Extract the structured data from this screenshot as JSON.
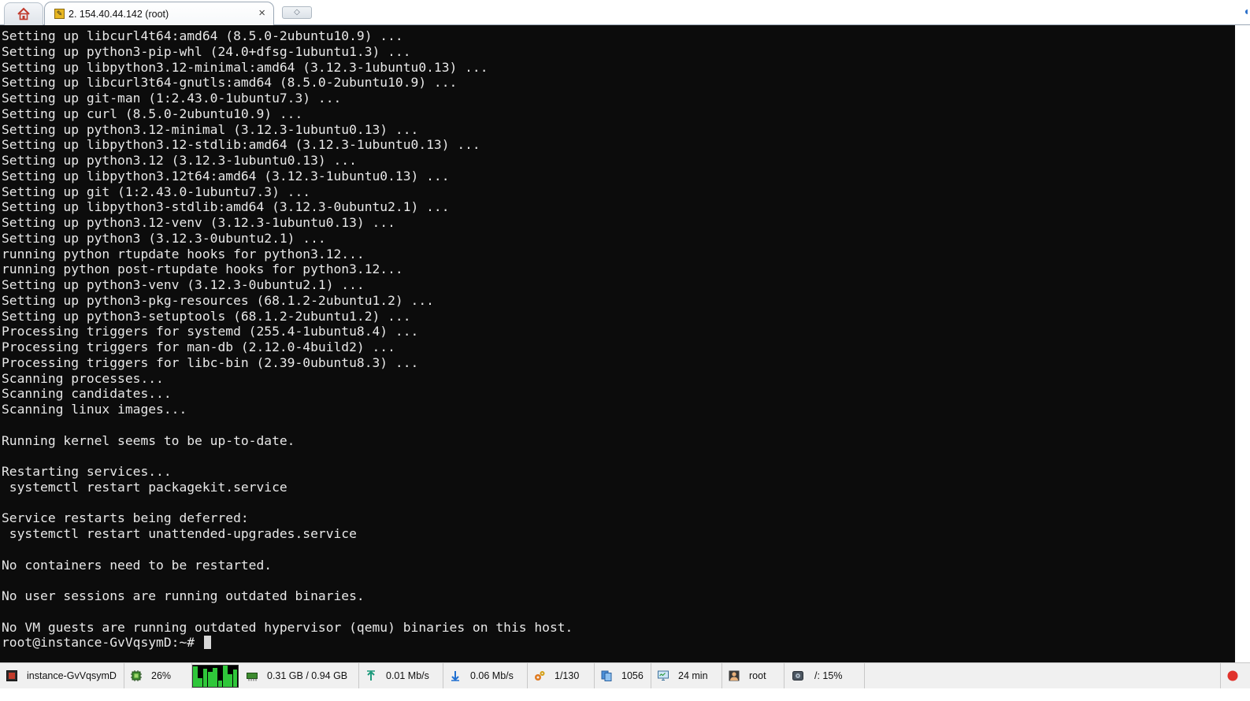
{
  "tabs": {
    "home_icon": "home-icon",
    "session_title": "2. 154.40.44.142 (root)",
    "session_icon": "terminal-icon",
    "close_glyph": "×",
    "new_tab_glyph": "◇"
  },
  "terminal": {
    "lines": [
      "Setting up libcurl4t64:amd64 (8.5.0-2ubuntu10.9) ...",
      "Setting up python3-pip-whl (24.0+dfsg-1ubuntu1.3) ...",
      "Setting up libpython3.12-minimal:amd64 (3.12.3-1ubuntu0.13) ...",
      "Setting up libcurl3t64-gnutls:amd64 (8.5.0-2ubuntu10.9) ...",
      "Setting up git-man (1:2.43.0-1ubuntu7.3) ...",
      "Setting up curl (8.5.0-2ubuntu10.9) ...",
      "Setting up python3.12-minimal (3.12.3-1ubuntu0.13) ...",
      "Setting up libpython3.12-stdlib:amd64 (3.12.3-1ubuntu0.13) ...",
      "Setting up python3.12 (3.12.3-1ubuntu0.13) ...",
      "Setting up libpython3.12t64:amd64 (3.12.3-1ubuntu0.13) ...",
      "Setting up git (1:2.43.0-1ubuntu7.3) ...",
      "Setting up libpython3-stdlib:amd64 (3.12.3-0ubuntu2.1) ...",
      "Setting up python3.12-venv (3.12.3-1ubuntu0.13) ...",
      "Setting up python3 (3.12.3-0ubuntu2.1) ...",
      "running python rtupdate hooks for python3.12...",
      "running python post-rtupdate hooks for python3.12...",
      "Setting up python3-venv (3.12.3-0ubuntu2.1) ...",
      "Setting up python3-pkg-resources (68.1.2-2ubuntu1.2) ...",
      "Setting up python3-setuptools (68.1.2-2ubuntu1.2) ...",
      "Processing triggers for systemd (255.4-1ubuntu8.4) ...",
      "Processing triggers for man-db (2.12.0-4build2) ...",
      "Processing triggers for libc-bin (2.39-0ubuntu8.3) ...",
      "Scanning processes...",
      "Scanning candidates...",
      "Scanning linux images...",
      "",
      "Running kernel seems to be up-to-date.",
      "",
      "Restarting services...",
      " systemctl restart packagekit.service",
      "",
      "Service restarts being deferred:",
      " systemctl restart unattended-upgrades.service",
      "",
      "No containers need to be restarted.",
      "",
      "No user sessions are running outdated binaries.",
      "",
      "No VM guests are running outdated hypervisor (qemu) binaries on this host."
    ],
    "prompt": "root@instance-GvVqsymD:~# "
  },
  "status_bar": {
    "host": "instance-GvVqsymD",
    "cpu": "26%",
    "cpu_graph_levels": [
      0.95,
      0.4,
      0.85,
      0.7,
      0.9,
      0.3,
      1.0,
      0.6,
      0.8
    ],
    "memory": "0.31 GB / 0.94 GB",
    "upload": "0.01 Mb/s",
    "download": "0.06 Mb/s",
    "processes": "1/130",
    "files": "1056",
    "uptime": "24 min",
    "user": "root",
    "disk": "/: 15%"
  },
  "colors": {
    "terminal_bg": "#0c0c0c",
    "terminal_fg": "#e8e8e8",
    "graph_green": "#2fc73a",
    "statusbar_bg": "#f0f0f0"
  }
}
